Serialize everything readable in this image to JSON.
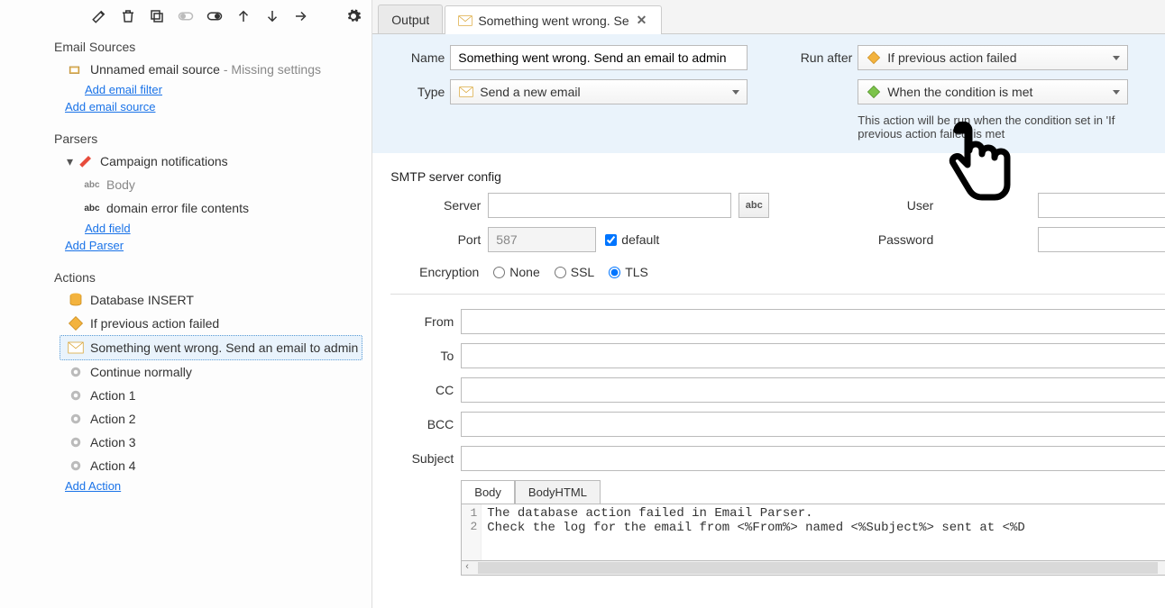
{
  "toolbar": {
    "icons": [
      "edit",
      "delete",
      "copy",
      "toggle-off",
      "toggle-on",
      "arrow-up",
      "arrow-down",
      "redirect",
      "gear"
    ]
  },
  "sidebar": {
    "sections": {
      "emailSources": {
        "title": "Email Sources",
        "items": [
          {
            "label": "Unnamed email source",
            "suffix": " - Missing settings"
          }
        ],
        "links": [
          "Add email filter",
          "Add email source"
        ]
      },
      "parsers": {
        "title": "Parsers",
        "items": [
          {
            "label": "Campaign notifications",
            "ico": "pencil-red"
          },
          {
            "label": "Body",
            "ico": "abc",
            "muted": true
          },
          {
            "label": "domain error file contents",
            "ico": "abc"
          }
        ],
        "links": [
          "Add field",
          "Add Parser"
        ]
      },
      "actions": {
        "title": "Actions",
        "items": [
          {
            "label": "Database INSERT",
            "ico": "db"
          },
          {
            "label": "If previous action failed",
            "ico": "diamond"
          },
          {
            "label": "Something went wrong. Send an email to admin",
            "ico": "mail",
            "selected": true
          },
          {
            "label": "Continue normally",
            "ico": "gear-gray"
          },
          {
            "label": "Action 1",
            "ico": "gear-gray"
          },
          {
            "label": "Action 2",
            "ico": "gear-gray"
          },
          {
            "label": "Action 3",
            "ico": "gear-gray"
          },
          {
            "label": "Action 4",
            "ico": "gear-gray"
          }
        ],
        "links": [
          "Add Action"
        ]
      }
    }
  },
  "tabs": [
    {
      "label": "Output",
      "closable": false,
      "active": false
    },
    {
      "label": "Something went wrong. Se",
      "closable": true,
      "active": true,
      "ico": "mail"
    }
  ],
  "form": {
    "name": {
      "label": "Name",
      "value": "Something went wrong. Send an email to admin"
    },
    "type": {
      "label": "Type",
      "value": "Send a new email"
    },
    "runAfter": {
      "label": "Run after",
      "value1": "If previous action failed",
      "value2": "When the condition is met",
      "note": "This action will be run when the condition set in 'If previous action failed' is met"
    }
  },
  "smtp": {
    "title": "SMTP server config",
    "server": {
      "label": "Server",
      "value": ""
    },
    "port": {
      "label": "Port",
      "value": "587",
      "default_label": "default",
      "default_checked": true
    },
    "user": {
      "label": "User",
      "value": ""
    },
    "password": {
      "label": "Password",
      "value": ""
    },
    "encryption": {
      "label": "Encryption",
      "options": [
        "None",
        "SSL",
        "TLS"
      ],
      "selected": "TLS"
    }
  },
  "email": {
    "from": {
      "label": "From",
      "value": ""
    },
    "to": {
      "label": "To",
      "value": ""
    },
    "cc": {
      "label": "CC",
      "value": ""
    },
    "bcc": {
      "label": "BCC",
      "value": ""
    },
    "subject": {
      "label": "Subject",
      "value": ""
    }
  },
  "bodyTabs": [
    "Body",
    "BodyHTML"
  ],
  "bodyLines": [
    "The database action failed in Email Parser.",
    "Check the log for the email from <%From%> named <%Subject%> sent at <%D"
  ],
  "abc": "abc"
}
